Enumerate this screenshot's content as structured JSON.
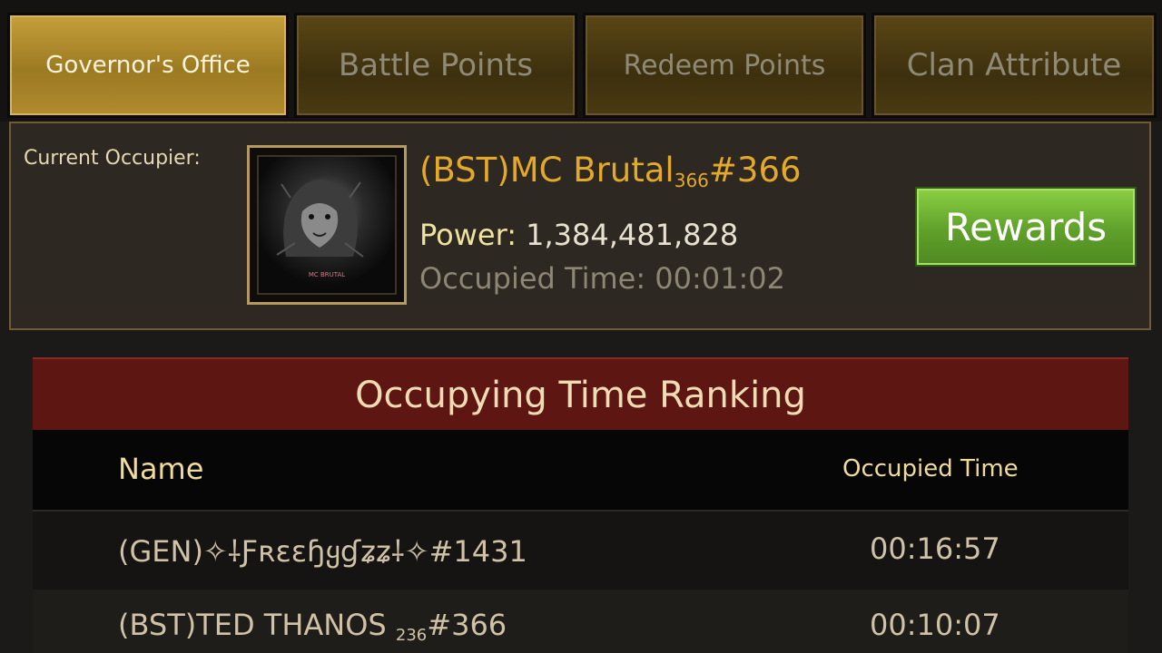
{
  "tabs": [
    {
      "label": "Governor's Office",
      "active": true
    },
    {
      "label": "Battle Points",
      "active": false
    },
    {
      "label": "Redeem Points",
      "active": false
    },
    {
      "label": "Clan Attribute",
      "active": false
    }
  ],
  "occupier": {
    "label": "Current Occupier:",
    "name_prefix": "(BST)MC Brutal",
    "name_sub": "366",
    "name_suffix": "#366",
    "power_label": "Power:",
    "power_value": "1,384,481,828",
    "occupied_time_text": "Occupied Time: 00:01:02",
    "avatar_caption": "MC BRUTAL",
    "rewards_label": "Rewards"
  },
  "ranking": {
    "title": "Occupying Time Ranking",
    "col_name": "Name",
    "col_time": "Occupied Time",
    "rows": [
      {
        "name": "(GEN)✧⸸Ƒʀεεɧყɠʑʑ⸸✧#1431",
        "name_sub": "",
        "name_suffix": "",
        "time": "00:16:57"
      },
      {
        "name": "(BST)TED THANOS ",
        "name_sub": "236",
        "name_suffix": "#366",
        "time": "00:10:07"
      }
    ]
  },
  "colors": {
    "accent_gold": "#e5a92a",
    "rewards_green": "#6cb232",
    "ranking_red": "#5e1613"
  }
}
